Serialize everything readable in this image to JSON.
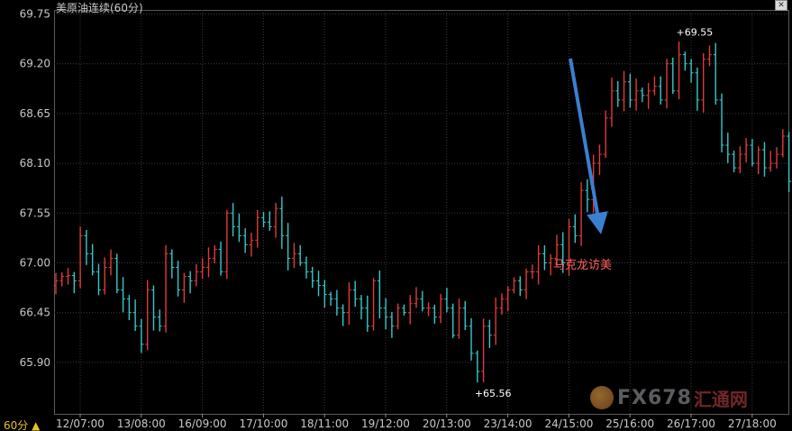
{
  "header": {
    "title": "美原油连续(60分)",
    "close_icon": "close-icon"
  },
  "footer": {
    "period_label": "60分 ▲"
  },
  "watermark": {
    "brand": "FX678",
    "site": "汇通网"
  },
  "colors": {
    "background": "#000000",
    "up": "#e03a3a",
    "down": "#36c8c8",
    "grid": "#3a3a3a",
    "axis_text": "#c8c8c8",
    "arrow": "#3a7fd0",
    "annotation": "#ff6060"
  },
  "chart_data": {
    "type": "ohlc",
    "title": "美原油连续(60分)",
    "yticks": [
      "69.75",
      "69.20",
      "68.65",
      "68.10",
      "67.55",
      "67.00",
      "66.45",
      "65.90"
    ],
    "ylim": [
      65.6,
      69.75
    ],
    "grid": true,
    "xticks": [
      "12/07:00",
      "13/08:00",
      "16/09:00",
      "17/10:00",
      "18/11:00",
      "19/12:00",
      "20/13:00",
      "23/14:00",
      "24/15:00",
      "25/16:00",
      "26/17:00",
      "27/18:00"
    ],
    "bars_per_tick": 10,
    "closes": [
      66.8,
      66.85,
      66.86,
      66.8,
      67.3,
      67.1,
      66.9,
      66.7,
      66.95,
      67.05,
      66.7,
      66.6,
      66.45,
      66.3,
      66.1,
      66.7,
      66.4,
      66.3,
      67.1,
      66.95,
      66.7,
      66.85,
      66.8,
      66.9,
      66.95,
      67.05,
      67.15,
      66.9,
      67.55,
      67.4,
      67.3,
      67.2,
      67.25,
      67.5,
      67.45,
      67.4,
      67.6,
      67.3,
      67.05,
      67.1,
      67.0,
      66.9,
      66.8,
      66.75,
      66.65,
      66.6,
      66.5,
      66.45,
      66.7,
      66.6,
      66.5,
      66.3,
      66.8,
      66.5,
      66.4,
      66.3,
      66.5,
      66.45,
      66.55,
      66.6,
      66.5,
      66.5,
      66.4,
      66.6,
      66.5,
      66.2,
      66.5,
      66.3,
      66.0,
      65.8,
      66.3,
      66.2,
      66.5,
      66.6,
      66.7,
      66.8,
      66.7,
      66.9,
      66.9,
      67.1,
      67.0,
      67.05,
      67.2,
      67.0,
      67.4,
      67.3,
      67.8,
      67.7,
      68.1,
      68.2,
      68.6,
      68.9,
      68.8,
      69.0,
      68.8,
      68.9,
      68.85,
      68.9,
      68.95,
      68.8,
      69.2,
      68.9,
      69.3,
      69.2,
      69.1,
      68.8,
      69.25,
      69.3,
      68.8,
      68.3,
      68.2,
      68.05,
      68.2,
      68.3,
      68.1,
      68.25,
      68.05,
      68.1,
      68.2,
      68.4,
      67.9,
      67.7,
      68.05,
      68.4,
      68.1,
      68.25,
      68.1,
      68.2,
      68.2,
      68.25,
      68.3,
      68.1,
      68.2,
      68.3,
      68.15,
      67.8,
      67.9,
      68.2,
      67.6,
      68.2,
      68.8,
      68.9,
      69.0,
      69.1,
      68.9,
      69.0,
      69.05,
      69.0,
      69.1,
      69.2,
      69.25,
      69.2,
      69.3,
      68.9,
      68.6,
      68.3,
      68.0,
      67.6,
      67.5,
      67.6,
      67.55,
      67.7,
      67.6,
      67.5,
      67.7,
      67.6,
      67.55,
      67.6,
      67.45,
      67.2,
      67.7,
      68.05,
      67.9,
      68.0,
      68.25,
      68.3,
      68.4,
      68.3,
      68.35,
      68.2,
      68.25,
      68.1,
      68.3,
      68.2,
      68.5,
      68.6,
      68.15,
      68.0,
      68.2,
      68.1,
      68.05,
      68.05,
      68.0,
      67.95,
      68.0,
      67.9,
      68.0,
      68.1,
      68.1,
      68.0,
      68.2,
      67.85,
      68.05,
      68.2,
      68.3,
      68.05
    ],
    "annotations": [
      {
        "text": "69.55",
        "kind": "high"
      },
      {
        "text": "65.56",
        "kind": "low"
      },
      {
        "text": "马克龙访美",
        "kind": "event"
      }
    ]
  }
}
